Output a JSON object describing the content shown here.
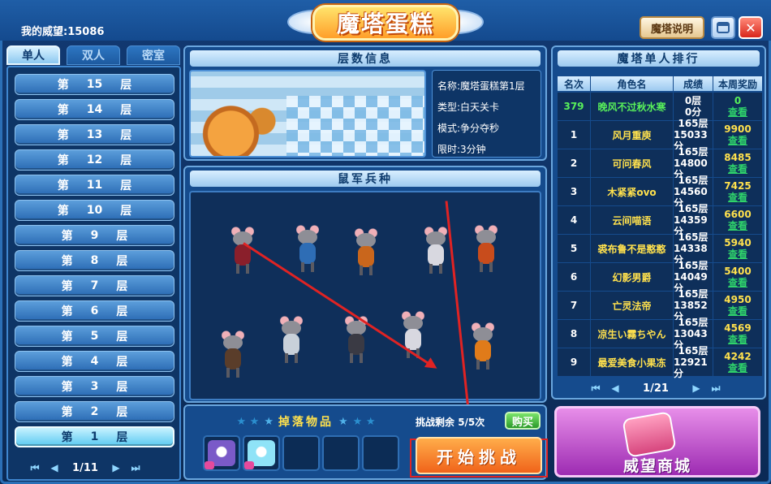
{
  "header": {
    "prestige": "我的威望:15086",
    "title": "魔塔蛋糕",
    "help_label": "魔塔说明",
    "window_icon": "window-icon",
    "close_label": "✕",
    "colors": {
      "frame": "#2b6fb6",
      "title_fill": "#ff9f2a"
    }
  },
  "left": {
    "tabs": [
      "单人",
      "双人",
      "密室"
    ],
    "floors": [
      {
        "a": "第",
        "n": "15",
        "b": "层"
      },
      {
        "a": "第",
        "n": "14",
        "b": "层"
      },
      {
        "a": "第",
        "n": "13",
        "b": "层"
      },
      {
        "a": "第",
        "n": "12",
        "b": "层"
      },
      {
        "a": "第",
        "n": "11",
        "b": "层"
      },
      {
        "a": "第",
        "n": "10",
        "b": "层"
      },
      {
        "a": "第",
        "n": "9",
        "b": "层"
      },
      {
        "a": "第",
        "n": "8",
        "b": "层"
      },
      {
        "a": "第",
        "n": "7",
        "b": "层"
      },
      {
        "a": "第",
        "n": "6",
        "b": "层"
      },
      {
        "a": "第",
        "n": "5",
        "b": "层"
      },
      {
        "a": "第",
        "n": "4",
        "b": "层"
      },
      {
        "a": "第",
        "n": "3",
        "b": "层"
      },
      {
        "a": "第",
        "n": "2",
        "b": "层"
      },
      {
        "a": "第",
        "n": "1",
        "b": "层"
      }
    ],
    "selected_floor": "1",
    "pager": "1/11"
  },
  "floor_info": {
    "title": "层数信息",
    "name": "名称:魔塔蛋糕第1层",
    "type": "类型:白天关卡",
    "mode": "模式:争分夺秒",
    "limit": "限时:3分钟"
  },
  "troops": {
    "title": "鼠军兵种",
    "body_colors": [
      "#8a1f2b",
      "#2e6db5",
      "#c9661c",
      "#d8d8e0",
      "#c84c1c",
      "#5a3d2a",
      "#c9d1da",
      "#3a3a44",
      "#d8d8e0",
      "#e07b1a"
    ]
  },
  "drops": {
    "title": "掉落物品",
    "items": [
      {
        "icon": "winged-pet-icon",
        "color": "#7a5ac8"
      },
      {
        "icon": "ice-crystal-icon",
        "color": "#8fe3f7"
      },
      {
        "icon": "",
        "color": ""
      },
      {
        "icon": "",
        "color": ""
      },
      {
        "icon": "",
        "color": ""
      }
    ]
  },
  "challenge": {
    "remaining_label": "挑战剩余",
    "remaining_count": "5/5次",
    "buy_label": "购买",
    "start_label": "开始挑战"
  },
  "ranking": {
    "title": "魔塔单人排行",
    "headers": [
      "名次",
      "角色名",
      "成绩",
      "本周奖励"
    ],
    "rows": [
      {
        "rank": "379",
        "name": "晚风不过秋水寒",
        "floor": "0层",
        "score": "0分",
        "reward": "0",
        "view": "查看",
        "mine": true
      },
      {
        "rank": "1",
        "name": "风月重庾",
        "floor": "165层",
        "score": "15033分",
        "reward": "9900",
        "view": "查看"
      },
      {
        "rank": "2",
        "name": "可问春风",
        "floor": "165层",
        "score": "14800分",
        "reward": "8485",
        "view": "查看"
      },
      {
        "rank": "3",
        "name": "木紧紧ovo",
        "floor": "165层",
        "score": "14560分",
        "reward": "7425",
        "view": "查看"
      },
      {
        "rank": "4",
        "name": "云间喵语",
        "floor": "165层",
        "score": "14359分",
        "reward": "6600",
        "view": "查看"
      },
      {
        "rank": "5",
        "name": "裘布鲁不是憨憨",
        "floor": "165层",
        "score": "14338分",
        "reward": "5940",
        "view": "查看"
      },
      {
        "rank": "6",
        "name": "幻影男爵",
        "floor": "165层",
        "score": "14049分",
        "reward": "5400",
        "view": "查看"
      },
      {
        "rank": "7",
        "name": "亡灵法帝",
        "floor": "165层",
        "score": "13852分",
        "reward": "4950",
        "view": "查看"
      },
      {
        "rank": "8",
        "name": "凉生い霧ちやん",
        "floor": "165层",
        "score": "13043分",
        "reward": "4569",
        "view": "查看"
      },
      {
        "rank": "9",
        "name": "最爱美食小果冻",
        "floor": "165层",
        "score": "12921分",
        "reward": "4242",
        "view": "查看"
      }
    ],
    "pager": "1/21"
  },
  "shop": {
    "label": "威望商城"
  }
}
